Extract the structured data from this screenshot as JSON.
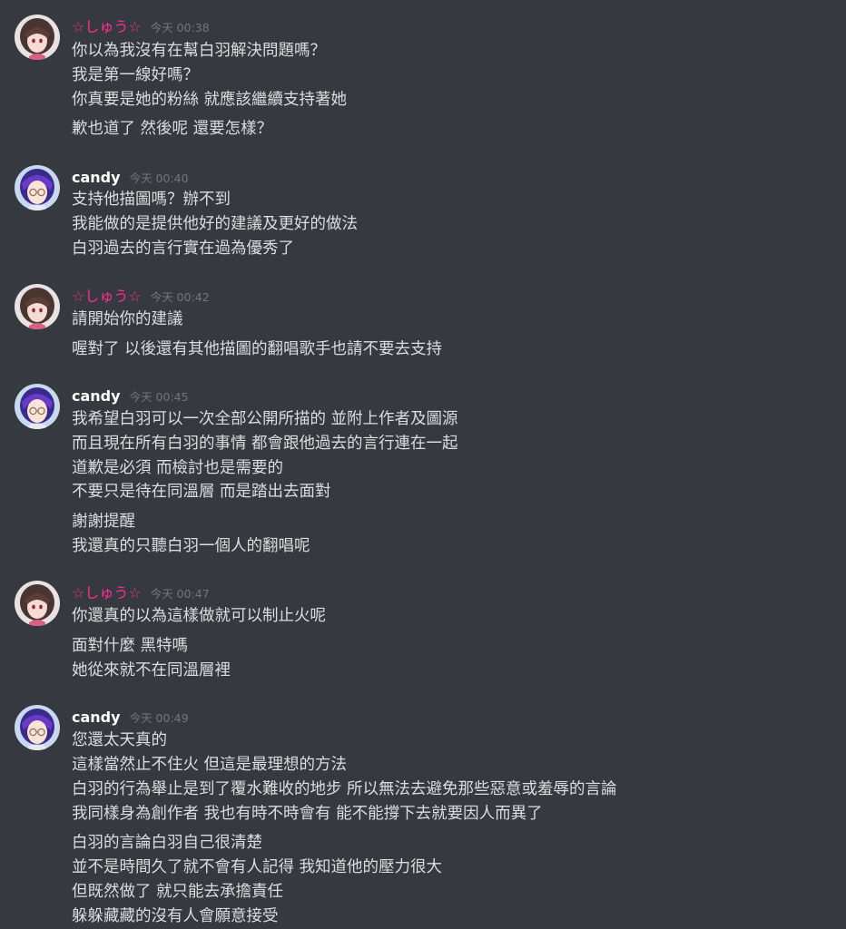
{
  "colors": {
    "background": "#36393f",
    "text": "#dcddde",
    "username_candy": "#ffffff",
    "username_shu": "#ff2e8f",
    "timestamp": "#72767d"
  },
  "messages": [
    {
      "author": "☆しゅう☆",
      "avatar": "anime-girl-brown-hair-avatar",
      "time": "今天 00:38",
      "lines": [
        "你以為我沒有在幫白羽解決問題嗎？",
        "我是第一線好嗎？",
        "你真要是她的粉絲 就應該繼續支持著她",
        "歉也道了 然後呢 還要怎樣？"
      ]
    },
    {
      "author": "candy",
      "avatar": "anime-girl-purple-hair-glasses-avatar",
      "time": "今天 00:40",
      "lines": [
        "支持他描圖嗎？辦不到",
        "我能做的是提供他好的建議及更好的做法",
        "白羽過去的言行實在過為優秀了"
      ]
    },
    {
      "author": "☆しゅう☆",
      "avatar": "anime-girl-brown-hair-avatar",
      "time": "今天 00:42",
      "lines": [
        "請開始你的建議",
        "喔對了 以後還有其他描圖的翻唱歌手也請不要去支持"
      ]
    },
    {
      "author": "candy",
      "avatar": "anime-girl-purple-hair-glasses-avatar",
      "time": "今天 00:45",
      "lines": [
        "我希望白羽可以一次全部公開所描的 並附上作者及圖源",
        "而且現在所有白羽的事情 都會跟他過去的言行連在一起",
        "道歉是必須 而檢討也是需要的",
        "不要只是待在同溫層 而是踏出去面對",
        "謝謝提醒",
        "我還真的只聽白羽一個人的翻唱呢"
      ]
    },
    {
      "author": "☆しゅう☆",
      "avatar": "anime-girl-brown-hair-avatar",
      "time": "今天 00:47",
      "lines": [
        "你還真的以為這樣做就可以制止火呢",
        "面對什麼 黑特嗎",
        "她從來就不在同溫層裡"
      ]
    },
    {
      "author": "candy",
      "avatar": "anime-girl-purple-hair-glasses-avatar",
      "time": "今天 00:49",
      "lines": [
        "您還太天真的",
        "這樣當然止不住火 但這是最理想的方法",
        "白羽的行為舉止是到了覆水難收的地步 所以無法去避免那些惡意或羞辱的言論",
        "我同樣身為創作者 我也有時不時會有 能不能撐下去就要因人而異了",
        "白羽的言論白羽自己很清楚",
        "並不是時間久了就不會有人記得 我知道他的壓力很大",
        "但既然做了 就只能去承擔責任",
        "躲躲藏藏的沒有人會願意接受"
      ]
    }
  ]
}
